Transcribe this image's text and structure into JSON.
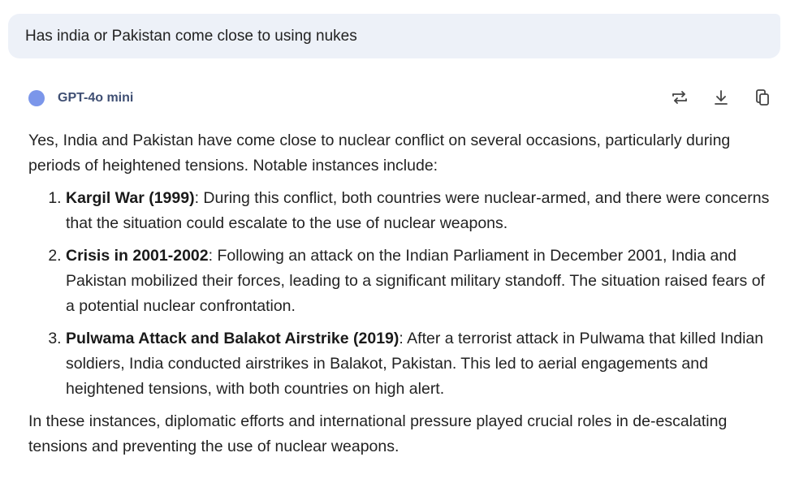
{
  "user_message": "Has india or Pakistan come close to using nukes",
  "model": {
    "name": "GPT-4o mini",
    "dot_color": "#7b96ea"
  },
  "actions": [
    {
      "icon": "regenerate-icon"
    },
    {
      "icon": "download-icon"
    },
    {
      "icon": "copy-icon"
    }
  ],
  "response": {
    "intro": "Yes, India and Pakistan have come close to nuclear conflict on several occasions, particularly during periods of heightened tensions. Notable instances include:",
    "items": [
      {
        "title": "Kargil War (1999)",
        "text": ": During this conflict, both countries were nuclear-armed, and there were concerns that the situation could escalate to the use of nuclear weapons."
      },
      {
        "title": "Crisis in 2001-2002",
        "text": ": Following an attack on the Indian Parliament in December 2001, India and Pakistan mobilized their forces, leading to a significant military standoff. The situation raised fears of a potential nuclear confrontation."
      },
      {
        "title": "Pulwama Attack and Balakot Airstrike (2019)",
        "text": ": After a terrorist attack in Pulwama that killed Indian soldiers, India conducted airstrikes in Balakot, Pakistan. This led to aerial engagements and heightened tensions, with both countries on high alert."
      }
    ],
    "conclusion": "In these instances, diplomatic efforts and international pressure played crucial roles in de-escalating tensions and preventing the use of nuclear weapons."
  }
}
